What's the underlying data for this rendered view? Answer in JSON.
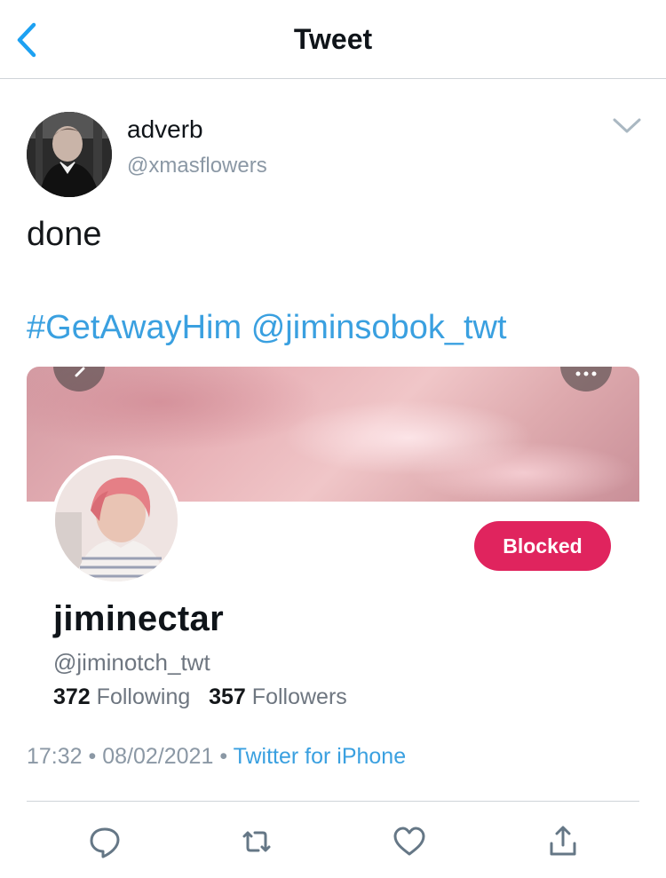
{
  "nav": {
    "title": "Tweet",
    "back_icon": "chevron-left-icon"
  },
  "tweet": {
    "author": {
      "name": "adverb",
      "handle": "@xmasflowers"
    },
    "text": "done",
    "hashtag": "#GetAwayHim",
    "mention": "@jiminsobok_twt",
    "time": "17:32",
    "separator": "•",
    "date": "08/02/2021",
    "source": "Twitter for iPhone"
  },
  "embedded_profile": {
    "name": "jiminectar",
    "handle": "@jiminotch_twt",
    "following_count": "372",
    "following_label": "Following",
    "followers_count": "357",
    "followers_label": "Followers",
    "status_button": "Blocked"
  },
  "actions": [
    "reply-icon",
    "retweet-icon",
    "like-icon",
    "share-icon"
  ],
  "colors": {
    "link": "#3aa0e0",
    "blocked": "#e0245e",
    "secondary_text": "#8b98a5"
  }
}
